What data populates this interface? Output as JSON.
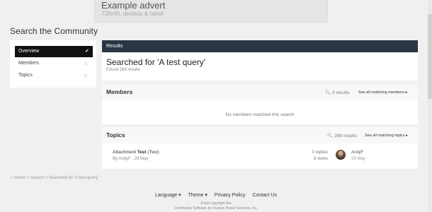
{
  "advert": {
    "title": "Example advert",
    "subtitle": "728x90, desktop & tablet"
  },
  "page_title": "Search the Community",
  "sidebar": {
    "items": [
      {
        "label": "Overview",
        "active": true,
        "mark": "✔"
      },
      {
        "label": "Members",
        "active": false
      },
      {
        "label": "Topics",
        "active": false
      }
    ]
  },
  "results": {
    "header": "Results",
    "query_title": "Searched for 'A test query'",
    "found": "Found 289 results"
  },
  "members": {
    "title": "Members",
    "count": "0 results",
    "link": "See all matching members ▸",
    "empty": "No members matched this search"
  },
  "topics": {
    "title": "Topics",
    "count": "289 results",
    "link": "See all matching topics ▸",
    "item": {
      "title_prefix": "Attachment",
      "title_bold": "Test",
      "title_suffix": "(Two)",
      "meta": "By AndyF , 29 May",
      "replies": "0 replies",
      "views": "8 views",
      "last_user": "AndyF",
      "last_date": "29 May"
    }
  },
  "breadcrumb": "⌂ Home  >  Search  >  Searched for 'A test query'",
  "footer": {
    "language": "Language ▾",
    "theme": "Theme ▾",
    "privacy": "Privacy Policy",
    "contact": "Contact Us",
    "copyright": "A test copyright line",
    "powered": "Community Software by Invision Power Services, Inc."
  }
}
